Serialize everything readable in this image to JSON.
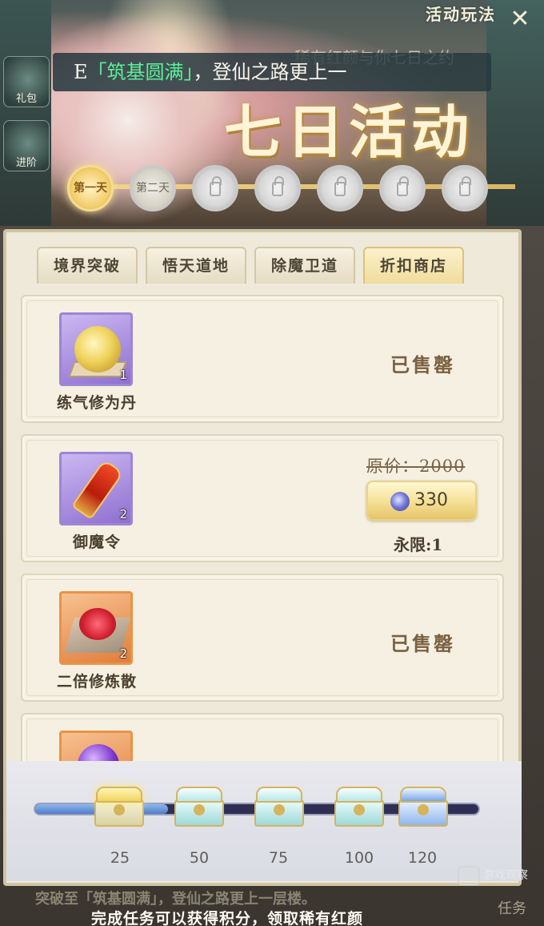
{
  "header": {
    "rules_label": "活动玩法",
    "ticker_prefix": "E",
    "ticker_highlight": "「筑基圆满」",
    "ticker_suffix": "，登仙之路更上一",
    "ticker_background_text": "稀有红颜与你七日之约",
    "event_title": "七日活动",
    "side_labels": [
      "礼包",
      "进阶"
    ],
    "days": [
      {
        "label": "第一天",
        "state": "active"
      },
      {
        "label": "第二天",
        "state": "done"
      },
      {
        "label": "",
        "state": "locked"
      },
      {
        "label": "",
        "state": "locked"
      },
      {
        "label": "",
        "state": "locked"
      },
      {
        "label": "",
        "state": "locked"
      },
      {
        "label": "",
        "state": "locked"
      }
    ]
  },
  "tabs": [
    {
      "label": "境界突破",
      "active": false
    },
    {
      "label": "悟天道地",
      "active": false
    },
    {
      "label": "除魔卫道",
      "active": false
    },
    {
      "label": "折扣商店",
      "active": true
    }
  ],
  "shop_items": [
    {
      "name": "练气修为丹",
      "count": "1",
      "status": "已售罄",
      "icon": "golden-orb-icon",
      "rarity": "purple"
    },
    {
      "name": "御魔令",
      "count": "2",
      "original_price": "原价：2000",
      "price": "330",
      "limit": "永限:1",
      "icon": "demon-token-icon",
      "rarity": "purple"
    },
    {
      "name": "二倍修炼散",
      "count": "2",
      "status": "已售罄",
      "icon": "red-powder-icon",
      "rarity": "orange"
    },
    {
      "name": "",
      "count": "",
      "icon": "purple-orb-icon",
      "rarity": "orange"
    }
  ],
  "progress": {
    "fill_fraction": 0.3,
    "milestones": [
      "25",
      "50",
      "75",
      "100",
      "120"
    ]
  },
  "footer": {
    "line1": "突破至「筑基圆满」，登仙之路更上一层楼。",
    "line2": "完成任务可以获得积分，领取稀有红颜",
    "task_label": "任务"
  },
  "watermark": "游戏观察"
}
